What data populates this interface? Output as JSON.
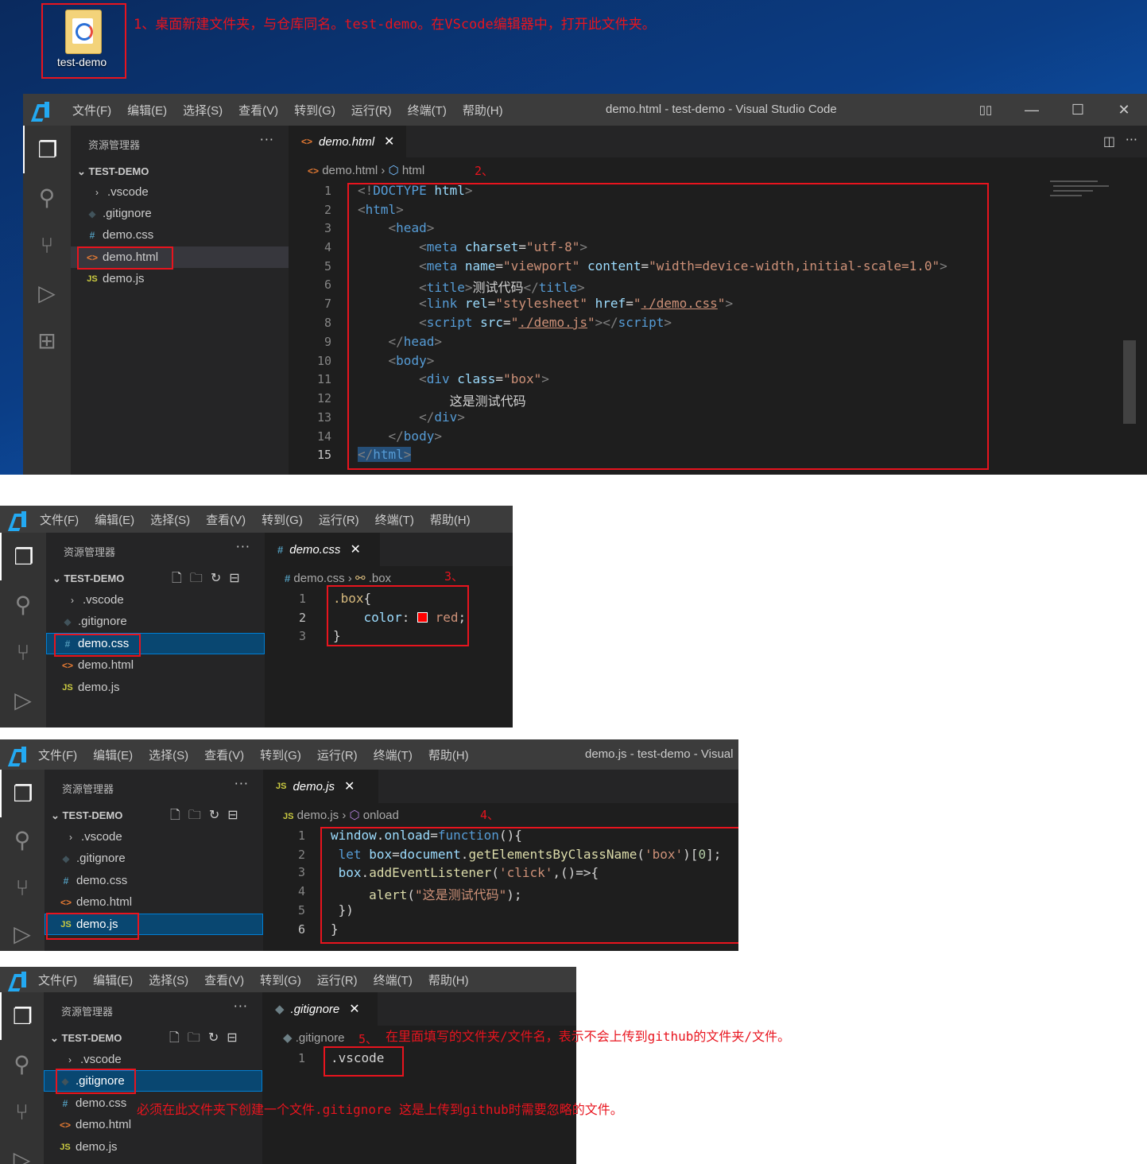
{
  "desktop": {
    "folder_label": "test-demo",
    "step1": "1、桌面新建文件夹，与仓库同名。test-demo。在VScode编辑器中，打开此文件夹。"
  },
  "menu": [
    "文件(F)",
    "编辑(E)",
    "选择(S)",
    "查看(V)",
    "转到(G)",
    "运行(R)",
    "终端(T)",
    "帮助(H)"
  ],
  "win1": {
    "title": "demo.html - test-demo - Visual Studio Code",
    "explorer": "资源管理器",
    "project": "TEST-DEMO",
    "files": [
      {
        "icon": ">",
        "name": ".vscode"
      },
      {
        "icon": "◆",
        "name": ".gitignore"
      },
      {
        "icon": "#",
        "name": "demo.css"
      },
      {
        "icon": "<>",
        "name": "demo.html"
      },
      {
        "icon": "JS",
        "name": "demo.js"
      }
    ],
    "tab": "demo.html",
    "crumb_file": "demo.html",
    "crumb_sym": "html",
    "step": "2、",
    "lines": [
      "1",
      "2",
      "3",
      "4",
      "5",
      "6",
      "7",
      "8",
      "9",
      "10",
      "11",
      "12",
      "13",
      "14",
      "15"
    ]
  },
  "win2": {
    "explorer": "资源管理器",
    "project": "TEST-DEMO",
    "tab": "demo.css",
    "crumb_file": "demo.css",
    "crumb_sym": ".box",
    "step": "3、",
    "lines": [
      "1",
      "2",
      "3"
    ]
  },
  "win3": {
    "title": "demo.js - test-demo - Visual",
    "explorer": "资源管理器",
    "project": "TEST-DEMO",
    "tab": "demo.js",
    "crumb_file": "demo.js",
    "crumb_sym": "onload",
    "step": "4、",
    "lines": [
      "1",
      "2",
      "3",
      "4",
      "5",
      "6"
    ]
  },
  "win4": {
    "explorer": "资源管理器",
    "project": "TEST-DEMO",
    "tab": ".gitignore",
    "crumb_file": ".gitignore",
    "step": "5、",
    "note5": "在里面填写的文件夹/文件名，表示不会上传到github的文件夹/文件。",
    "note_must": "必须在此文件夹下创建一个文件.gitignore 这是上传到github时需要忽略的文件。",
    "code": ".vscode",
    "lines": [
      "1"
    ]
  },
  "colors": {
    "editor_bg": "#1e1e1e",
    "sidebar_bg": "#252526",
    "titlebar_bg": "#3c3c3c",
    "annotation": "#e8141e",
    "selection": "#094771"
  }
}
